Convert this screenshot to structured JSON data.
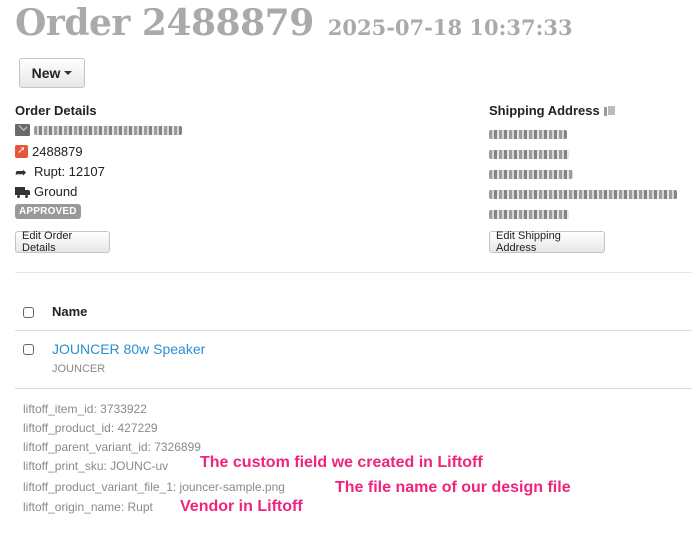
{
  "header": {
    "title": "Order 2488879",
    "datetime": "2025-07-18 10:37:33"
  },
  "toolbar": {
    "new_label": "New"
  },
  "order_details": {
    "title": "Order Details",
    "order_number": "2488879",
    "rupt_label": "Rupt: 12107",
    "shipping_method": "Ground",
    "status": "APPROVED",
    "edit_button": "Edit Order Details"
  },
  "shipping_address": {
    "title": "Shipping Address",
    "edit_button": "Edit Shipping Address"
  },
  "table": {
    "column_name": "Name"
  },
  "item": {
    "name": "JOUNCER 80w Speaker",
    "vendor": "JOUNCER",
    "fields": [
      "liftoff_item_id: 3733922",
      "liftoff_product_id: 427229",
      "liftoff_parent_variant_id: 7326899",
      "liftoff_print_sku: JOUNC-uv",
      "liftoff_product_variant_file_1: jouncer-sample.png",
      "liftoff_origin_name: Rupt"
    ]
  },
  "annotations": [
    "The custom field we created in Liftoff",
    "The file name of our design file",
    "Vendor in Liftoff"
  ],
  "colors": {
    "link": "#2a8fd0",
    "annotation": "#f0247c",
    "badge": "#999999"
  }
}
